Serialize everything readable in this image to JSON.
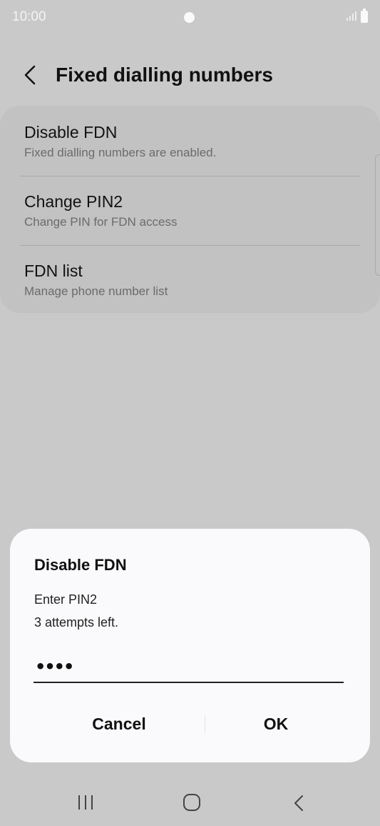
{
  "status_bar": {
    "time": "10:00"
  },
  "header": {
    "title": "Fixed dialling numbers"
  },
  "settings": {
    "items": [
      {
        "title": "Disable FDN",
        "subtitle": "Fixed dialling numbers are enabled."
      },
      {
        "title": "Change PIN2",
        "subtitle": "Change PIN for FDN access"
      },
      {
        "title": "FDN list",
        "subtitle": "Manage phone number list"
      }
    ]
  },
  "dialog": {
    "title": "Disable FDN",
    "message_line1": "Enter PIN2",
    "message_line2": "3 attempts left.",
    "pin_value": "••••",
    "cancel_label": "Cancel",
    "ok_label": "OK"
  },
  "nav_bar": {
    "icons": [
      "recents-icon",
      "home-icon",
      "back-icon"
    ]
  },
  "colors": {
    "background": "#c9c9c9",
    "card": "#c2c2c2",
    "dialog": "#fafafc",
    "text": "#111111",
    "subtext": "#6b6b6b"
  }
}
